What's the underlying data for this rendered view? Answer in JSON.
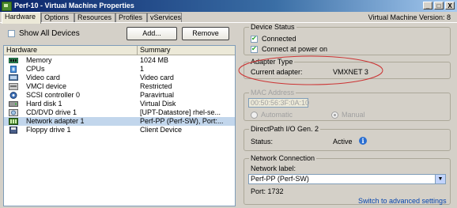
{
  "window": {
    "title": "Perf-10 - Virtual Machine Properties",
    "minimize_glyph": "_",
    "maximize_glyph": "□",
    "close_glyph": "X"
  },
  "tabs": [
    {
      "label": "Hardware",
      "active": true
    },
    {
      "label": "Options",
      "active": false
    },
    {
      "label": "Resources",
      "active": false
    },
    {
      "label": "Profiles",
      "active": false
    },
    {
      "label": "vServices",
      "active": false
    }
  ],
  "vm_version": "Virtual Machine Version: 8",
  "toolbar": {
    "show_all_label": "Show All Devices",
    "add_label": "Add...",
    "remove_label": "Remove"
  },
  "hardware_table": {
    "headers": [
      "Hardware",
      "Summary"
    ],
    "rows": [
      {
        "icon": "memory-icon",
        "name": "Memory",
        "summary": "1024 MB"
      },
      {
        "icon": "cpu-icon",
        "name": "CPUs",
        "summary": "1"
      },
      {
        "icon": "video-card-icon",
        "name": "Video card",
        "summary": "Video card"
      },
      {
        "icon": "vmci-icon",
        "name": "VMCI device",
        "summary": "Restricted"
      },
      {
        "icon": "scsi-icon",
        "name": "SCSI controller 0",
        "summary": "Paravirtual"
      },
      {
        "icon": "hard-disk-icon",
        "name": "Hard disk 1",
        "summary": "Virtual Disk"
      },
      {
        "icon": "cd-dvd-icon",
        "name": "CD/DVD drive 1",
        "summary": "[UPT-Datastore] rhel-se..."
      },
      {
        "icon": "network-adapter-icon",
        "name": "Network adapter 1",
        "summary": "Perf-PP (Perf-SW), Port:...",
        "selected": true
      },
      {
        "icon": "floppy-icon",
        "name": "Floppy drive 1",
        "summary": "Client Device"
      }
    ]
  },
  "device_status": {
    "title": "Device Status",
    "connected_label": "Connected",
    "connect_power_label": "Connect at power on"
  },
  "adapter_type": {
    "title": "Adapter Type",
    "current_label": "Current adapter:",
    "current_value": "VMXNET 3"
  },
  "mac_address": {
    "title": "MAC Address",
    "value": "00:50:56:3F:0A:10",
    "automatic_label": "Automatic",
    "manual_label": "Manual"
  },
  "directpath": {
    "title": "DirectPath I/O Gen. 2",
    "status_label": "Status:",
    "status_value": "Active"
  },
  "network_connection": {
    "title": "Network Connection",
    "label_label": "Network label:",
    "selected_network": "Perf-PP (Perf-SW)",
    "port_text": "Port:  1732",
    "switch_link": "Switch to advanced settings"
  },
  "colors": {
    "annotation_ellipse": "#cc3333",
    "selection": "#c2d6ec",
    "link": "#0645ad"
  }
}
